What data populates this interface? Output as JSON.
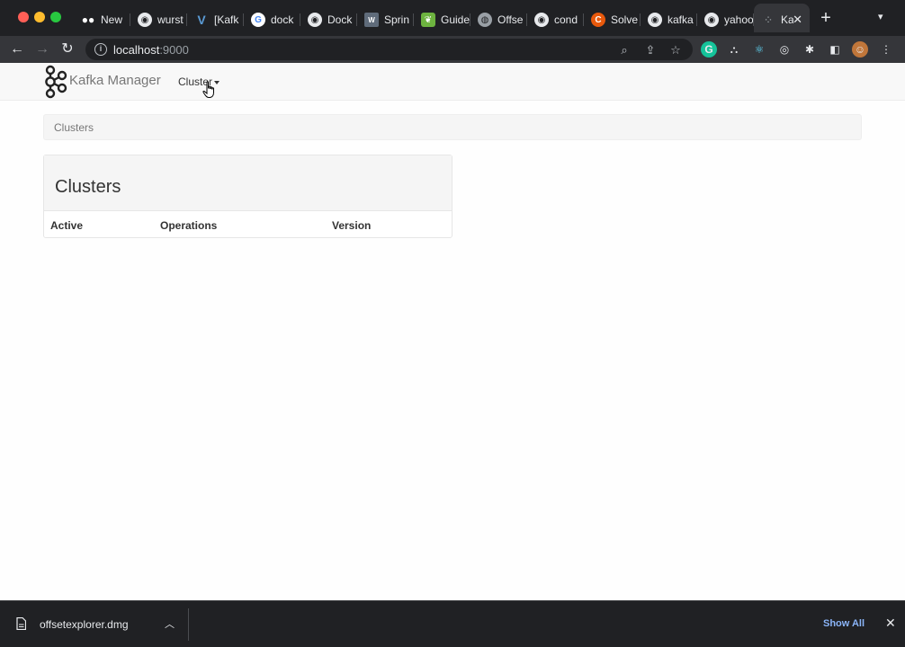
{
  "browser": {
    "tabs": [
      {
        "label": "New",
        "icon": "medium-icon"
      },
      {
        "label": "wurst",
        "icon": "github-icon"
      },
      {
        "label": "[Kafk",
        "icon": "v-icon"
      },
      {
        "label": "dock",
        "icon": "google-icon"
      },
      {
        "label": "Dock",
        "icon": "github-icon"
      },
      {
        "label": "Sprin",
        "icon": "spring-doc-icon"
      },
      {
        "label": "Guide",
        "icon": "spring-icon"
      },
      {
        "label": "Offse",
        "icon": "globe-icon"
      },
      {
        "label": "cond",
        "icon": "github-icon"
      },
      {
        "label": "Solve",
        "icon": "c-icon"
      },
      {
        "label": "kafka",
        "icon": "github-icon"
      },
      {
        "label": "yahoo",
        "icon": "github-icon"
      },
      {
        "label": "Ka",
        "icon": "kafka-icon",
        "active": true
      }
    ],
    "new_tab_label": "+",
    "url_host": "localhost",
    "url_port": ":9000"
  },
  "app": {
    "brand": "Kafka Manager",
    "nav_cluster": "Cluster"
  },
  "breadcrumb": "Clusters",
  "panel": {
    "title": "Clusters",
    "columns": [
      "Active",
      "Operations",
      "Version"
    ]
  },
  "download": {
    "filename": "offsetexplorer.dmg",
    "show_all": "Show All"
  },
  "colors": {
    "chrome_dark": "#202124",
    "toolbar": "#35363a",
    "link_blue": "#8ab4f8"
  }
}
